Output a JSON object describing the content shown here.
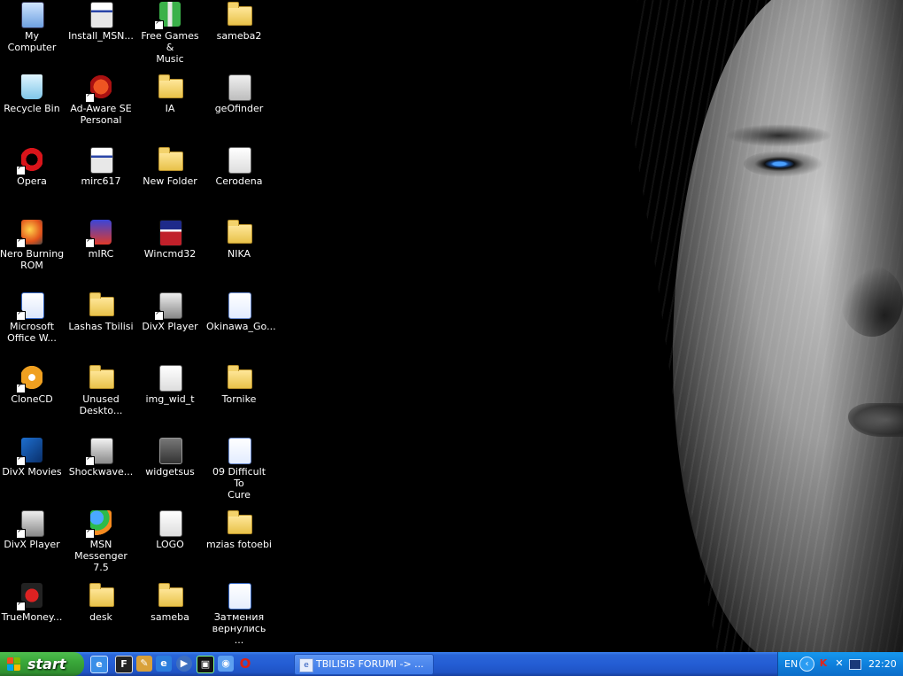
{
  "desktop": {
    "icons": [
      {
        "label": "My Computer",
        "icon": "my-computer-icon",
        "shortcut": false
      },
      {
        "label": "Recycle Bin",
        "icon": "recycle-bin-icon",
        "shortcut": false
      },
      {
        "label": "Opera",
        "icon": "opera-icon",
        "shortcut": true
      },
      {
        "label": "Nero Burning\nROM",
        "icon": "nero-icon",
        "shortcut": true
      },
      {
        "label": "Microsoft\nOffice W...",
        "icon": "word-icon",
        "shortcut": true
      },
      {
        "label": "CloneCD",
        "icon": "clonecd-icon",
        "shortcut": true
      },
      {
        "label": "DivX Movies",
        "icon": "divx-movies-icon",
        "shortcut": true
      },
      {
        "label": "DivX Player",
        "icon": "divx-player-icon",
        "shortcut": true
      },
      {
        "label": "TrueMoney...",
        "icon": "truemoney-icon",
        "shortcut": true
      },
      {
        "label": "Install_MSN...",
        "icon": "installer-icon",
        "shortcut": false
      },
      {
        "label": "Ad-Aware SE\nPersonal",
        "icon": "adaware-icon",
        "shortcut": true
      },
      {
        "label": "mirc617",
        "icon": "installer-icon",
        "shortcut": false
      },
      {
        "label": "mIRC",
        "icon": "mirc-icon",
        "shortcut": true
      },
      {
        "label": "Lashas Tbilisi",
        "icon": "folder-icon",
        "shortcut": false
      },
      {
        "label": "Unused\nDeskto...",
        "icon": "folder-icon",
        "shortcut": false
      },
      {
        "label": "Shockwave...",
        "icon": "shockwave-icon",
        "shortcut": true
      },
      {
        "label": "MSN\nMessenger 7.5",
        "icon": "msn-messenger-icon",
        "shortcut": true
      },
      {
        "label": "desk",
        "icon": "folder-icon",
        "shortcut": false
      },
      {
        "label": "Free Games &\nMusic",
        "icon": "gift-icon",
        "shortcut": true
      },
      {
        "label": "IA",
        "icon": "folder-icon",
        "shortcut": false
      },
      {
        "label": "New Folder",
        "icon": "folder-icon",
        "shortcut": false
      },
      {
        "label": "Wincmd32",
        "icon": "floppy-icon",
        "shortcut": false
      },
      {
        "label": "DivX Player",
        "icon": "divx-player-icon",
        "shortcut": true
      },
      {
        "label": "img_wid_t",
        "icon": "image-viewer-icon",
        "shortcut": false
      },
      {
        "label": "widgetsus",
        "icon": "yahoo-widget-icon",
        "shortcut": false
      },
      {
        "label": "LOGO",
        "icon": "image-viewer-icon",
        "shortcut": false
      },
      {
        "label": "sameba",
        "icon": "folder-icon",
        "shortcut": false
      },
      {
        "label": "sameba2",
        "icon": "folder-icon",
        "shortcut": false
      },
      {
        "label": "geOfinder",
        "icon": "phone-icon",
        "shortcut": false
      },
      {
        "label": "Cerodena",
        "icon": "image-viewer-icon",
        "shortcut": false
      },
      {
        "label": "NIKA",
        "icon": "folder-icon",
        "shortcut": false
      },
      {
        "label": "Okinawa_Go...",
        "icon": "media-file-icon",
        "shortcut": false
      },
      {
        "label": "Tornike",
        "icon": "folder-icon",
        "shortcut": false
      },
      {
        "label": "09 Difficult To\nCure",
        "icon": "media-file-icon",
        "shortcut": false
      },
      {
        "label": "mzias fotoebi",
        "icon": "folder-icon",
        "shortcut": false
      },
      {
        "label": "Затмения\nвернулись ...",
        "icon": "word-document-icon",
        "shortcut": false
      }
    ]
  },
  "taskbar": {
    "start_label": "start",
    "quick_launch": [
      "ie-edit-icon",
      "far-manager-icon",
      "pencil-icon",
      "internet-explorer-icon",
      "media-player-icon",
      "terminal-icon",
      "geo-icon",
      "opera-icon"
    ],
    "task_item_label": "TBILISIS FORUMI -> ...",
    "tray": {
      "language": "EN",
      "clock": "22:20",
      "icons": [
        "kaspersky-icon",
        "network-icon",
        "monitor-icon"
      ]
    }
  },
  "colors": {
    "taskbar_blue": "#245dd4",
    "start_green": "#3aa83a",
    "tray_blue": "#0f81dd",
    "folder_yellow": "#f3d26b"
  }
}
